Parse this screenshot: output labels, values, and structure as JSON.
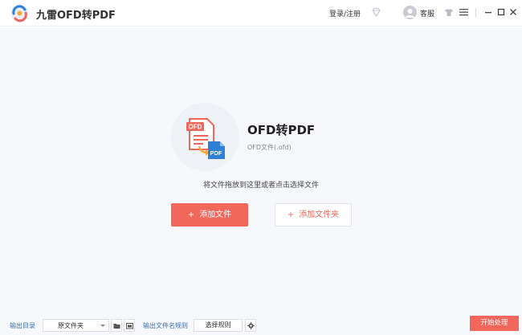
{
  "app": {
    "title": "九雷OFD转PDF"
  },
  "titlebar": {
    "login_label": "登录/注册",
    "service_label": "客服",
    "icons": [
      "app-logo-icon",
      "vip-diamond-icon",
      "avatar",
      "skin-shirt-icon",
      "menu-icon",
      "minimize-icon",
      "maximize-icon",
      "close-icon"
    ]
  },
  "main": {
    "heading": "OFD转PDF",
    "subheading": "OFD文件(.ofd)",
    "hint": "将文件拖放到这里或者点击选择文件",
    "add_file_label": "添加文件",
    "add_folder_label": "添加文件夹",
    "plus_symbol": "+",
    "icon_badge_top": "OFD",
    "icon_badge_bottom": "PDF"
  },
  "bottom": {
    "output_dir_label": "输出目录",
    "output_dir_value": "原文件夹",
    "naming_rule_label": "输出文件名规则",
    "choose_rule_label": "选择规则",
    "start_label": "开始处理"
  },
  "colors": {
    "accent": "#f2675c",
    "link_blue": "#3f6fb0",
    "workspace_bg": "#f6f8fb"
  }
}
